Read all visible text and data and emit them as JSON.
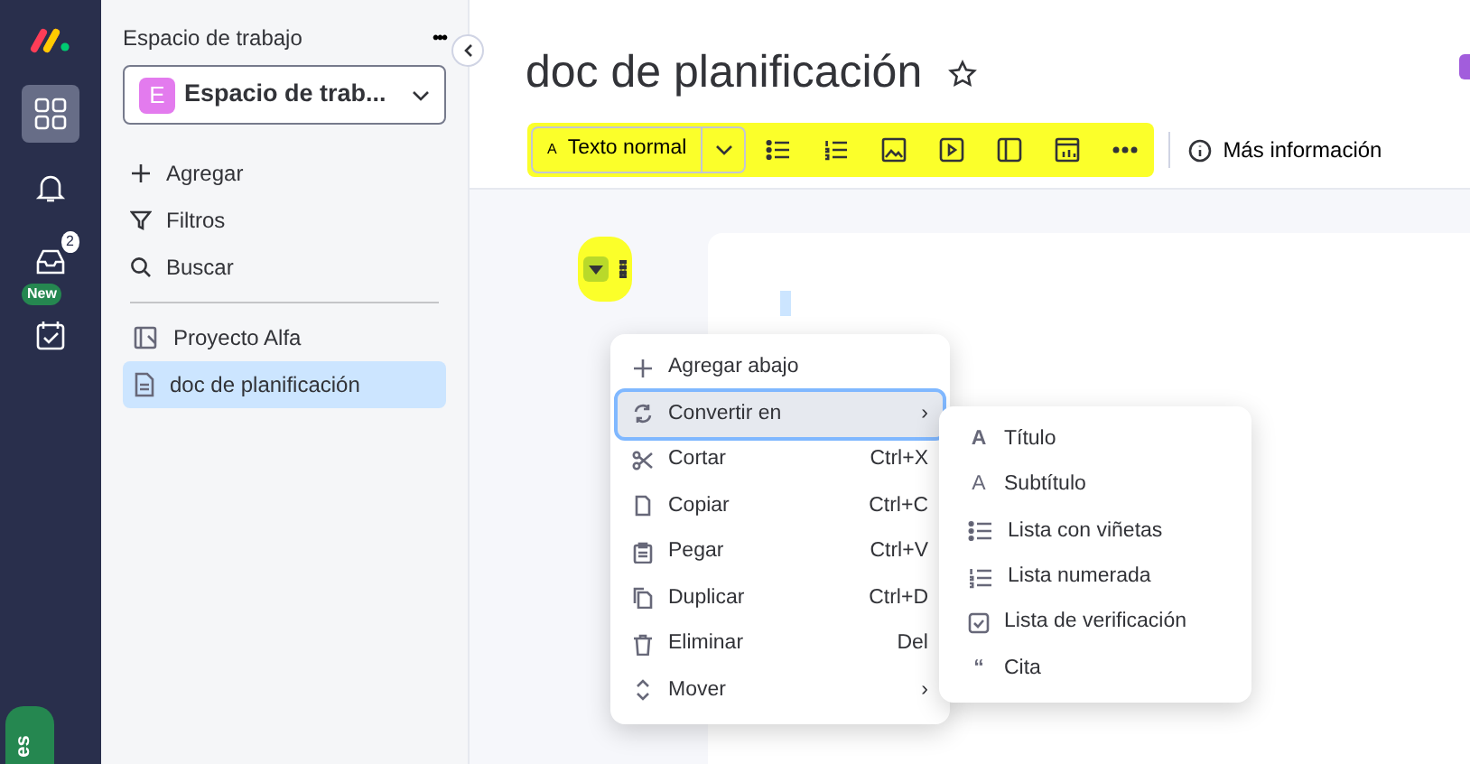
{
  "nav": {
    "items": [
      {
        "kind": "grid",
        "selected": true
      },
      {
        "kind": "bell",
        "selected": false
      },
      {
        "kind": "inbox",
        "selected": false,
        "badge": "2"
      },
      {
        "kind": "calendar",
        "selected": false,
        "badge": "New"
      }
    ],
    "bottom_tab": "es"
  },
  "sidebar": {
    "heading": "Espacio de trabajo",
    "more": "•••",
    "workspace": {
      "initial": "E",
      "name": "Espacio de trab..."
    },
    "actions": [
      {
        "kind": "add",
        "label": "Agregar"
      },
      {
        "kind": "filter",
        "label": "Filtros"
      },
      {
        "kind": "search",
        "label": "Buscar"
      }
    ],
    "items": [
      {
        "kind": "board",
        "label": "Proyecto Alfa",
        "selected": false
      },
      {
        "kind": "doc",
        "label": "doc de planificación",
        "selected": true
      }
    ]
  },
  "doc": {
    "title": "doc de planificación",
    "starred": false,
    "toolbar": {
      "highlighted": true,
      "style_button": {
        "icon": "A",
        "label": "Texto normal"
      },
      "tools": [
        {
          "kind": "bullets"
        },
        {
          "kind": "numbers"
        },
        {
          "kind": "image"
        },
        {
          "kind": "video"
        },
        {
          "kind": "layout"
        },
        {
          "kind": "chart"
        },
        {
          "kind": "more"
        }
      ],
      "info": "Más información"
    },
    "block_handle": {
      "highlighted": true
    }
  },
  "context_menu": {
    "items": [
      {
        "kind": "add",
        "label": "Agregar abajo",
        "selected": false
      },
      {
        "kind": "convert",
        "label": "Convertir en",
        "shortcut": "›",
        "selected": true
      },
      {
        "kind": "cut",
        "label": "Cortar",
        "shortcut": "Ctrl+X",
        "selected": false
      },
      {
        "kind": "copy",
        "label": "Copiar",
        "shortcut": "Ctrl+C",
        "selected": false
      },
      {
        "kind": "paste",
        "label": "Pegar",
        "shortcut": "Ctrl+V",
        "selected": false
      },
      {
        "kind": "duplicate",
        "label": "Duplicar",
        "shortcut": "Ctrl+D",
        "selected": false
      },
      {
        "kind": "delete",
        "label": "Eliminar",
        "shortcut": "Del",
        "selected": false
      },
      {
        "kind": "move",
        "label": "Mover",
        "shortcut": "›",
        "selected": false
      }
    ]
  },
  "submenu": {
    "items": [
      {
        "kind": "title",
        "icon": "A",
        "label": "Título"
      },
      {
        "kind": "subtitle",
        "icon": "A",
        "label": "Subtítulo"
      },
      {
        "kind": "bullets",
        "label": "Lista con viñetas"
      },
      {
        "kind": "numbers",
        "label": "Lista numerada"
      },
      {
        "kind": "check",
        "label": "Lista de verificación"
      },
      {
        "kind": "quote",
        "icon": "“",
        "label": "Cita"
      }
    ]
  }
}
